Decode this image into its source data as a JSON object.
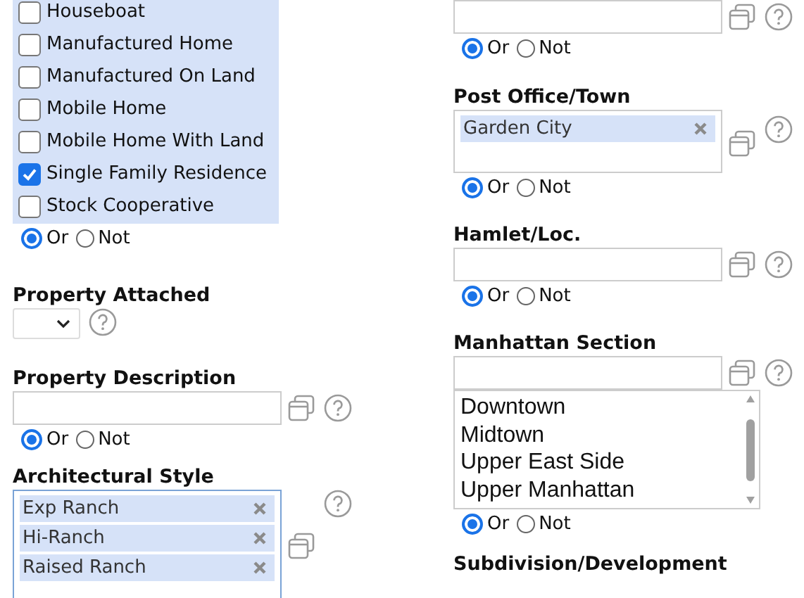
{
  "left": [
    {
      "kind": "checklist",
      "options": [
        {
          "label": "Houseboat",
          "checked": false
        },
        {
          "label": "Manufactured Home",
          "checked": false
        },
        {
          "label": "Manufactured On Land",
          "checked": false
        },
        {
          "label": "Mobile Home",
          "checked": false
        },
        {
          "label": "Mobile Home With Land",
          "checked": false
        },
        {
          "label": "Single Family Residence",
          "checked": true
        },
        {
          "label": "Stock Cooperative",
          "checked": false
        }
      ],
      "match": [
        {
          "label": "Or",
          "selected": true
        },
        {
          "label": "Not",
          "selected": false
        }
      ]
    },
    {
      "kind": "select",
      "label": "Property Attached"
    },
    {
      "kind": "text",
      "label": "Property Description",
      "match": [
        {
          "label": "Or",
          "selected": true
        },
        {
          "label": "Not",
          "selected": false
        }
      ]
    },
    {
      "kind": "tags",
      "label": "Architectural Style",
      "tags": [
        "Exp Ranch",
        "Hi-Ranch",
        "Raised Ranch"
      ]
    }
  ],
  "right": [
    {
      "kind": "text",
      "match": [
        {
          "label": "Or",
          "selected": true
        },
        {
          "label": "Not",
          "selected": false
        }
      ]
    },
    {
      "kind": "tags",
      "label": "Post Office/Town",
      "tags": [
        "Garden City"
      ],
      "match": [
        {
          "label": "Or",
          "selected": true
        },
        {
          "label": "Not",
          "selected": false
        }
      ]
    },
    {
      "kind": "text",
      "label": "Hamlet/Loc.",
      "match": [
        {
          "label": "Or",
          "selected": true
        },
        {
          "label": "Not",
          "selected": false
        }
      ]
    },
    {
      "kind": "listbox",
      "label": "Manhattan Section",
      "options": [
        "Downtown",
        "Midtown",
        "Upper East Side",
        "Upper Manhattan"
      ],
      "match": [
        {
          "label": "Or",
          "selected": true
        },
        {
          "label": "Not",
          "selected": false
        }
      ]
    },
    {
      "kind": "label",
      "label": "Subdivision/Development"
    }
  ]
}
